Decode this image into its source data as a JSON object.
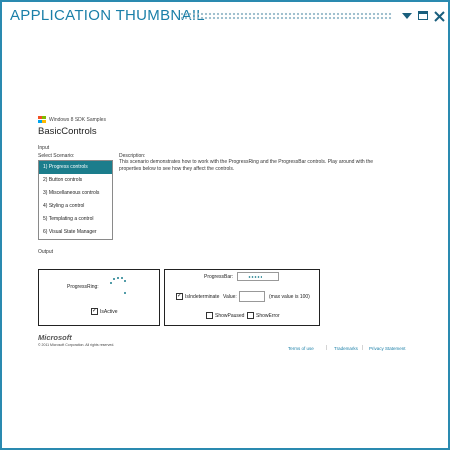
{
  "window": {
    "title": "APPLICATION THUMBNAIL"
  },
  "header": {
    "brand": "Windows 8 SDK Samples",
    "app_title": "BasicControls"
  },
  "input": {
    "section_label": "Input",
    "select_label": "Select Scenario:",
    "scenarios": [
      "1) Progress controls",
      "2) Button controls",
      "3) Miscellaneous controls",
      "4) Styling a control",
      "5) Templating a control",
      "6) Visual State Manager"
    ],
    "selected_index": 0,
    "description_heading": "Description:",
    "description": "This scenario demonstrates how to work with the ProgressRing and the ProgressBar controls. Play around with the properties below to see how they affect the controls."
  },
  "output": {
    "section_label": "Output",
    "progress_ring_label": "ProgressRing:",
    "is_active_label": "IsActive",
    "is_active_checked": true,
    "progress_bar_label": "ProgressBar:",
    "is_indeterminate_label": "IsIndeterminate",
    "is_indeterminate_checked": true,
    "value_label": "Value:",
    "value_input": "",
    "max_note": "(max value is 100)",
    "show_paused_label": "ShowPaused",
    "show_error_label": "ShowError",
    "check_mark": "✓"
  },
  "footer": {
    "logo": "Microsoft",
    "copyright": "© 2011 Microsoft Corporation. All rights reserved.",
    "links": [
      "Terms of use",
      "Trademarks",
      "Privacy Statement"
    ],
    "separator": "|"
  },
  "colors": {
    "accent": "#1b7d8c",
    "title": "#1a7fa8",
    "link": "#1a7fa8"
  },
  "icons": {
    "window_menu": "dropdown-triangle-icon",
    "maximize": "maximize-icon",
    "close": "close-icon",
    "logo": "windows-flag-icon"
  }
}
